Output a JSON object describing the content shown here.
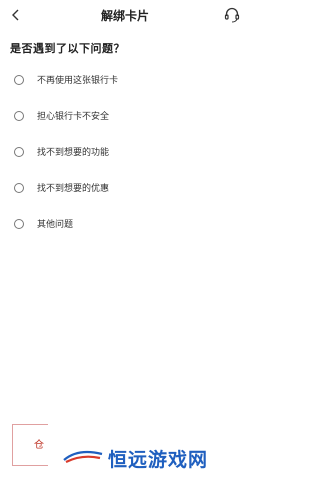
{
  "header": {
    "title": "解绑卡片"
  },
  "survey": {
    "question": "是否遇到了以下问题？",
    "options": [
      {
        "label": "不再使用这张银行卡"
      },
      {
        "label": "担心银行卡不安全"
      },
      {
        "label": "找不到想要的功能"
      },
      {
        "label": "找不到想要的优惠"
      },
      {
        "label": "其他问题"
      }
    ]
  },
  "footer": {
    "button_label": "仓"
  },
  "watermark": {
    "text": "恒远游戏网"
  },
  "colors": {
    "accent": "#c0392b",
    "watermark_blue": "#1f5fbf"
  }
}
